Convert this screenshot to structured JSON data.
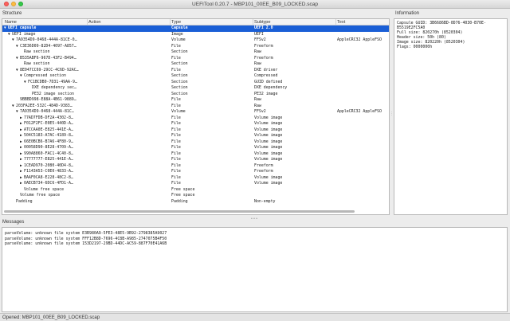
{
  "window": {
    "title": "UEFITool 0.20.7 - MBP101_00EE_B09_LOCKED.scap"
  },
  "structure": {
    "label": "Structure",
    "columns": [
      "Name",
      "Action",
      "Type",
      "Subtype",
      "Text"
    ],
    "rows": [
      {
        "arrow": "▼",
        "name": "UEFI capsule",
        "action": "",
        "type": "Capsule",
        "subtype": "UEFI 2.0",
        "text": "",
        "indent": 0,
        "selected": true
      },
      {
        "arrow": "▼",
        "name": "UEFI image",
        "action": "",
        "type": "Image",
        "subtype": "UEFI",
        "text": "",
        "indent": 1
      },
      {
        "arrow": "▼",
        "name": "7A9354D9-0468-444A-81CE-0…",
        "action": "",
        "type": "Volume",
        "subtype": "FFSv2",
        "text": "AppleCRC32 AppleFSO",
        "indent": 2
      },
      {
        "arrow": "▼",
        "name": "C3E36D09-82D4-4097-A857…",
        "action": "",
        "type": "File",
        "subtype": "Freeform",
        "text": "",
        "indent": 3
      },
      {
        "arrow": "",
        "name": "Raw section",
        "action": "",
        "type": "Section",
        "subtype": "Raw",
        "text": "",
        "indent": 4
      },
      {
        "arrow": "▼",
        "name": "B535ABF6-967D-43F2-B494…",
        "action": "",
        "type": "File",
        "subtype": "Freeform",
        "text": "",
        "indent": 3
      },
      {
        "arrow": "",
        "name": "Raw section",
        "action": "",
        "type": "Section",
        "subtype": "Raw",
        "text": "",
        "indent": 4
      },
      {
        "arrow": "▼",
        "name": "8E047CC69-29CC-4C6D-92AC…",
        "action": "",
        "type": "File",
        "subtype": "DXE driver",
        "text": "",
        "indent": 3
      },
      {
        "arrow": "▼",
        "name": "Compressed section",
        "action": "",
        "type": "Section",
        "subtype": "Compressed",
        "text": "",
        "indent": 4
      },
      {
        "arrow": "▼",
        "name": "FC1BCDB0-7D31-49AA-9…",
        "action": "",
        "type": "Section",
        "subtype": "GUID defined",
        "text": "",
        "indent": 5
      },
      {
        "arrow": "",
        "name": "DXE dependency sec…",
        "action": "",
        "type": "Section",
        "subtype": "DXE dependency",
        "text": "",
        "indent": 6
      },
      {
        "arrow": "",
        "name": "PE32 image section",
        "action": "",
        "type": "Section",
        "subtype": "PE32 image",
        "text": "",
        "indent": 6
      },
      {
        "arrow": "",
        "name": "9BBBD998-E88A-4B61-9889…",
        "action": "",
        "type": "File",
        "subtype": "Raw",
        "text": "",
        "indent": 3
      },
      {
        "arrow": "▼",
        "name": "203FA2EE-532C-484D-9383…",
        "action": "",
        "type": "File",
        "subtype": "Raw",
        "text": "",
        "indent": 2
      },
      {
        "arrow": "▼",
        "name": "7A9354D9-0468-444A-81C…",
        "action": "",
        "type": "Volume",
        "subtype": "FFSv2",
        "text": "AppleCRC32 AppleFSO",
        "indent": 3
      },
      {
        "arrow": "▶",
        "name": "77AD7FDB-DF2A-4302-8…",
        "action": "",
        "type": "File",
        "subtype": "Volume image",
        "text": "",
        "indent": 4
      },
      {
        "arrow": "▶",
        "name": "F012F2FC-E0E5-440D-A…",
        "action": "",
        "type": "File",
        "subtype": "Volume image",
        "text": "",
        "indent": 4
      },
      {
        "arrow": "▶",
        "name": "ATCCAA0E-E825-441E-A…",
        "action": "",
        "type": "File",
        "subtype": "Volume image",
        "text": "",
        "indent": 4
      },
      {
        "arrow": "▶",
        "name": "504C5183-A7AC-4189-8…",
        "action": "",
        "type": "File",
        "subtype": "Volume image",
        "text": "",
        "indent": 4
      },
      {
        "arrow": "▶",
        "name": "66E0BCB6-B7A6-4F80-9…",
        "action": "",
        "type": "File",
        "subtype": "Volume image",
        "text": "",
        "indent": 4
      },
      {
        "arrow": "▶",
        "name": "00058D90-8E28-4709-A…",
        "action": "",
        "type": "File",
        "subtype": "Volume image",
        "text": "",
        "indent": 4
      },
      {
        "arrow": "▶",
        "name": "990A8860-FAC1-4C40-8…",
        "action": "",
        "type": "File",
        "subtype": "Volume image",
        "text": "",
        "indent": 4
      },
      {
        "arrow": "▶",
        "name": "77777777-E825-441E-A…",
        "action": "",
        "type": "File",
        "subtype": "Volume image",
        "text": "",
        "indent": 4
      },
      {
        "arrow": "▶",
        "name": "1CEAD970-2080-40D4-8…",
        "action": "",
        "type": "File",
        "subtype": "Freeform",
        "text": "",
        "indent": 4
      },
      {
        "arrow": "▶",
        "name": "F1143A53-C0E0-4833-A…",
        "action": "",
        "type": "File",
        "subtype": "Freeform",
        "text": "",
        "indent": 4
      },
      {
        "arrow": "▶",
        "name": "BAAF0CA8-E228-48C2-8…",
        "action": "",
        "type": "File",
        "subtype": "Volume image",
        "text": "",
        "indent": 4
      },
      {
        "arrow": "▶",
        "name": "0AECB734-6DC6-4FD1-A…",
        "action": "",
        "type": "File",
        "subtype": "Volume image",
        "text": "",
        "indent": 4
      },
      {
        "arrow": "",
        "name": "Volume free space",
        "action": "",
        "type": "Free space",
        "subtype": "",
        "text": "",
        "indent": 4
      },
      {
        "arrow": "",
        "name": "Volume free space",
        "action": "",
        "type": "Free space",
        "subtype": "",
        "text": "",
        "indent": 3
      },
      {
        "arrow": "",
        "name": "Padding",
        "action": "",
        "type": "Padding",
        "subtype": "Non-empty",
        "text": "",
        "indent": 2
      }
    ]
  },
  "information": {
    "label": "Information",
    "lines": [
      "Capsule GUID: 3B6686BD-0D76-4030-B70E-",
      "B5519E2FC5A0",
      "Full size: 820270h (8520304)",
      "Header size: 50h (80)",
      "Image size: 820220h (8520304)",
      "Flags: 0000000h"
    ]
  },
  "messages": {
    "label": "Messages",
    "items": [
      "parseVolume: unknown file system E3B980A9-5FE3-48E5-9B92-2798385A9027",
      "parseVolume: unknown file system FFF12B8D-7696-4C8B-A985-2747075B4F50",
      "parseVolume: unknown file system 153D2197-29BD-44DC-AC59-887F70E41A6B"
    ]
  },
  "status": {
    "text": "Opened: MBP101_00EE_B09_LOCKED.scap"
  }
}
